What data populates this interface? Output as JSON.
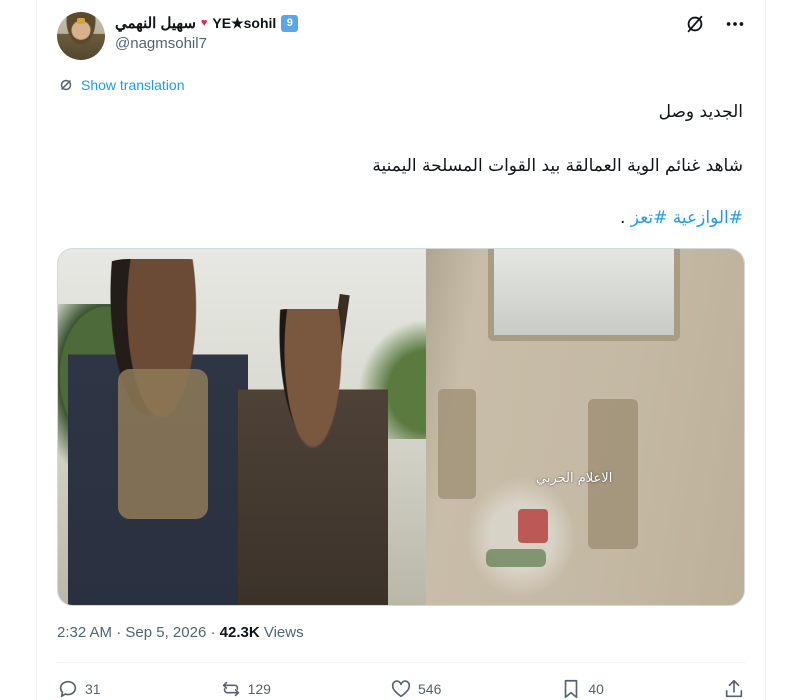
{
  "author": {
    "display_name": "سهيل النهمي",
    "heart": "♥",
    "handle_text": "YE★sohil",
    "verified_badge": "9",
    "username": "@nagmsohil7"
  },
  "translate_label": "Show translation",
  "tweet": {
    "line1": "الجديد وصل",
    "line2": "شاهد غنائم الوية العمالقة بيد القوات المسلحة اليمنية",
    "line3_prefix": ".",
    "hashtags": [
      "#الوازعية",
      "#تعز"
    ]
  },
  "media": {
    "watermark": "الاعلام الحربي"
  },
  "meta": {
    "time": "2:32 AM",
    "separator": " · ",
    "date": "Sep 5, 2026",
    "views_count": "42.3K",
    "views_label": " Views"
  },
  "actions": {
    "replies": "31",
    "reposts": "129",
    "likes": "546",
    "bookmarks": "40"
  },
  "icons": {
    "top_left": "grok-icon",
    "top_right": "more-icon",
    "translate": "translate-icon",
    "reply": "reply-icon",
    "repost": "repost-icon",
    "like": "like-icon",
    "bookmark": "bookmark-icon",
    "share": "share-icon"
  },
  "colors": {
    "accent": "#1d9bf0",
    "text": "#0f1419",
    "secondary": "#536471",
    "heart": "#e0245e"
  }
}
